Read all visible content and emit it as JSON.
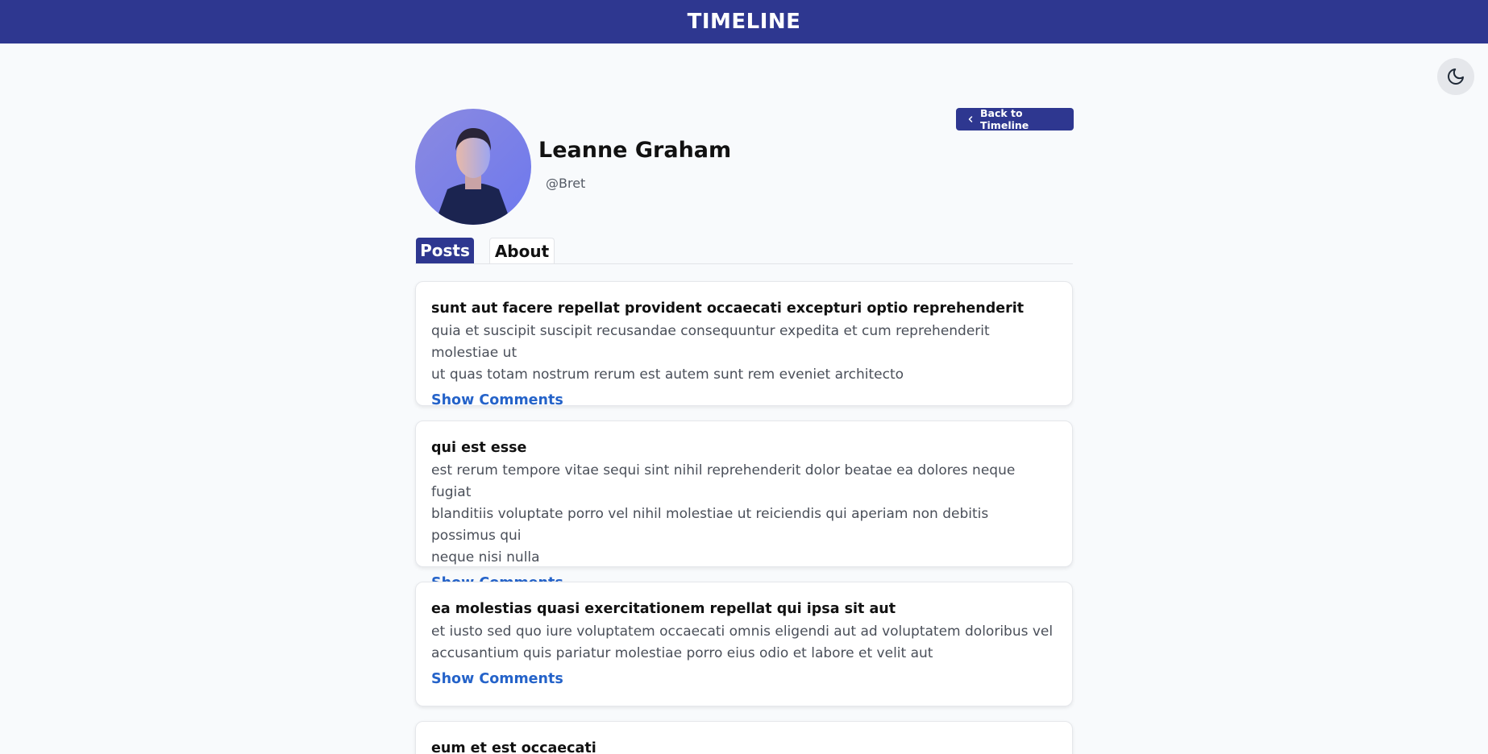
{
  "header": {
    "title": "TIMELINE"
  },
  "theme_toggle": {
    "icon": "moon-icon"
  },
  "profile": {
    "name": "Leanne Graham",
    "handle": "@Bret",
    "avatar_icon": "avatar-photo",
    "back_button": {
      "label": "Back to Timeline",
      "icon": "chevron-left-icon"
    }
  },
  "tabs": [
    {
      "label": "Posts",
      "active": true
    },
    {
      "label": "About",
      "active": false
    }
  ],
  "posts": [
    {
      "title": "sunt aut facere repellat provident occaecati excepturi optio reprehenderit",
      "body": "quia et suscipit suscipit recusandae consequuntur expedita et cum reprehenderit molestiae ut\nut quas totam nostrum rerum est autem sunt rem eveniet architecto",
      "action": "Show Comments"
    },
    {
      "title": "qui est esse",
      "body": "est rerum tempore vitae sequi sint nihil reprehenderit dolor beatae ea dolores neque fugiat\nblanditiis voluptate porro vel nihil molestiae ut reiciendis qui aperiam non debitis possimus qui\nneque nisi nulla",
      "action": "Show Comments"
    },
    {
      "title": "ea molestias quasi exercitationem repellat qui ipsa sit aut",
      "body": "et iusto sed quo iure voluptatem occaecati omnis eligendi aut ad voluptatem doloribus vel\naccusantium quis pariatur molestiae porro eius odio et labore et velit aut",
      "action": "Show Comments"
    },
    {
      "title": "eum et est occaecati",
      "body": "",
      "action": ""
    }
  ],
  "colors": {
    "primary": "#2e3790",
    "link": "#2563c9",
    "background": "#f8fafc"
  }
}
